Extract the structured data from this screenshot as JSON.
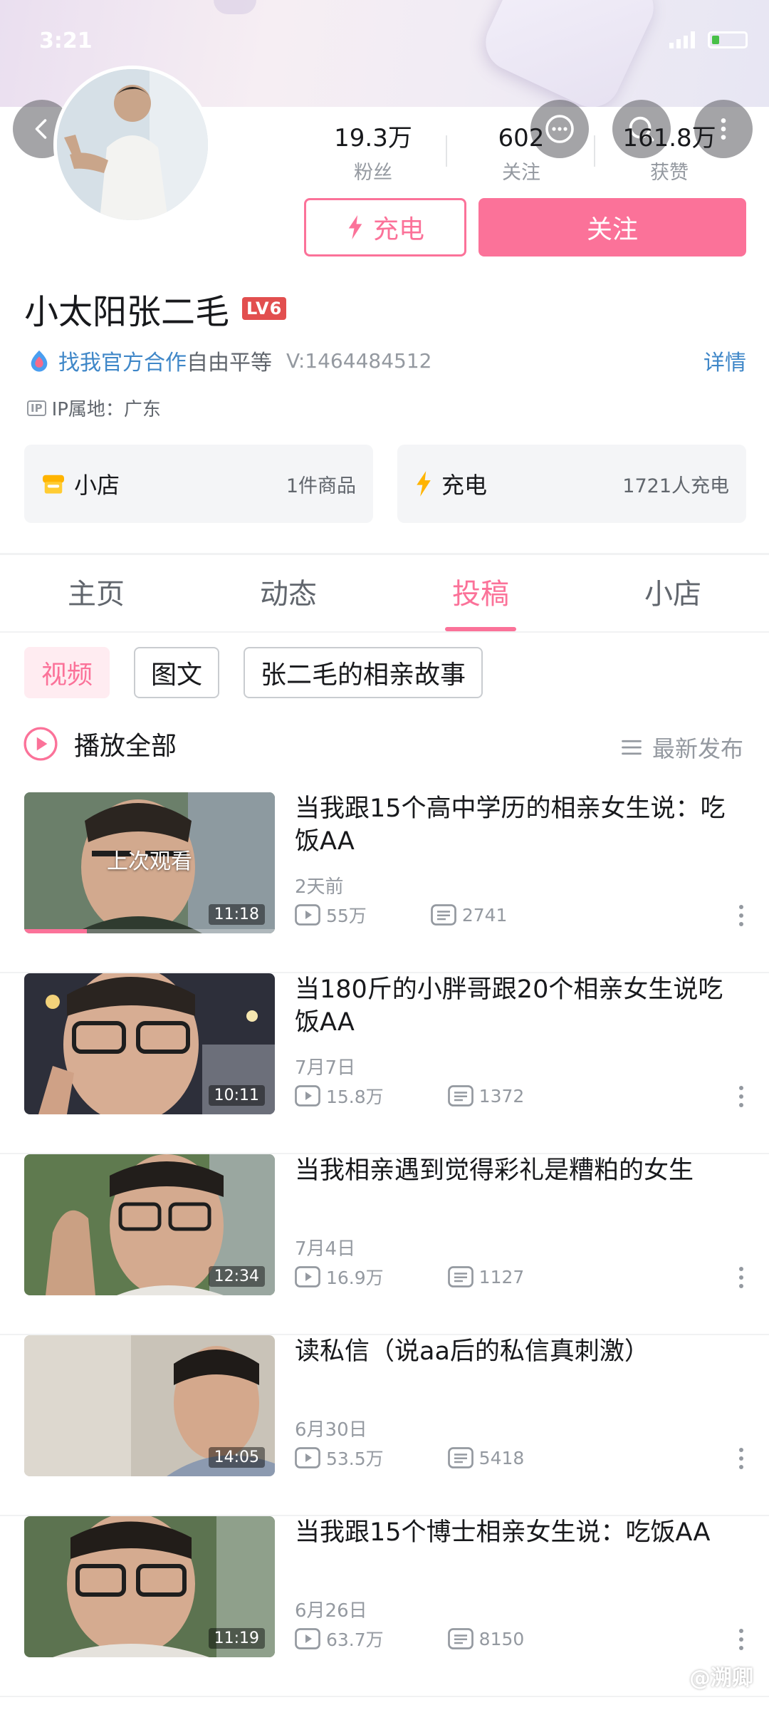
{
  "status_bar": {
    "time": "3:21"
  },
  "profile": {
    "name": "小太阳张二毛",
    "level": "LV6",
    "stats": [
      {
        "value": "19.3万",
        "label": "粉丝"
      },
      {
        "value": "602",
        "label": "关注"
      },
      {
        "value": "161.8万",
        "label": "获赞"
      }
    ],
    "charge_button": "充电",
    "follow_button": "关注",
    "bio_link": "找我官方合作",
    "bio_text": "自由平等",
    "uid": "V:1464484512",
    "detail_link": "详情",
    "ip_tag": "IP",
    "ip_location": "IP属地：广东"
  },
  "cards": {
    "shop": {
      "title": "小店",
      "meta": "1件商品"
    },
    "charge": {
      "title": "充电",
      "meta": "1721人充电"
    }
  },
  "tabs": [
    "主页",
    "动态",
    "投稿",
    "小店"
  ],
  "filters": [
    "视频",
    "图文",
    "张二毛的相亲故事"
  ],
  "list_header": {
    "play_all": "播放全部",
    "sort": "最新发布"
  },
  "videos": [
    {
      "title": "当我跟15个高中学历的相亲女生说：吃饭AA",
      "date": "2天前",
      "views": "55万",
      "comments": "2741",
      "duration": "11:18",
      "overlay": "上次观看",
      "watch_progress": 0.25
    },
    {
      "title": "当180斤的小胖哥跟20个相亲女生说吃饭AA",
      "date": "7月7日",
      "views": "15.8万",
      "comments": "1372",
      "duration": "10:11"
    },
    {
      "title": "当我相亲遇到觉得彩礼是糟粕的女生",
      "date": "7月4日",
      "views": "16.9万",
      "comments": "1127",
      "duration": "12:34"
    },
    {
      "title": "读私信（说aa后的私信真刺激）",
      "date": "6月30日",
      "views": "53.5万",
      "comments": "5418",
      "duration": "14:05"
    },
    {
      "title": "当我跟15个博士相亲女生说：吃饭AA",
      "date": "6月26日",
      "views": "63.7万",
      "comments": "8150",
      "duration": "11:19"
    }
  ],
  "watermark": "@溯卿",
  "colors": {
    "accent": "#fb7299",
    "link": "#3f87c8",
    "level_badge": "#e24f4f"
  }
}
